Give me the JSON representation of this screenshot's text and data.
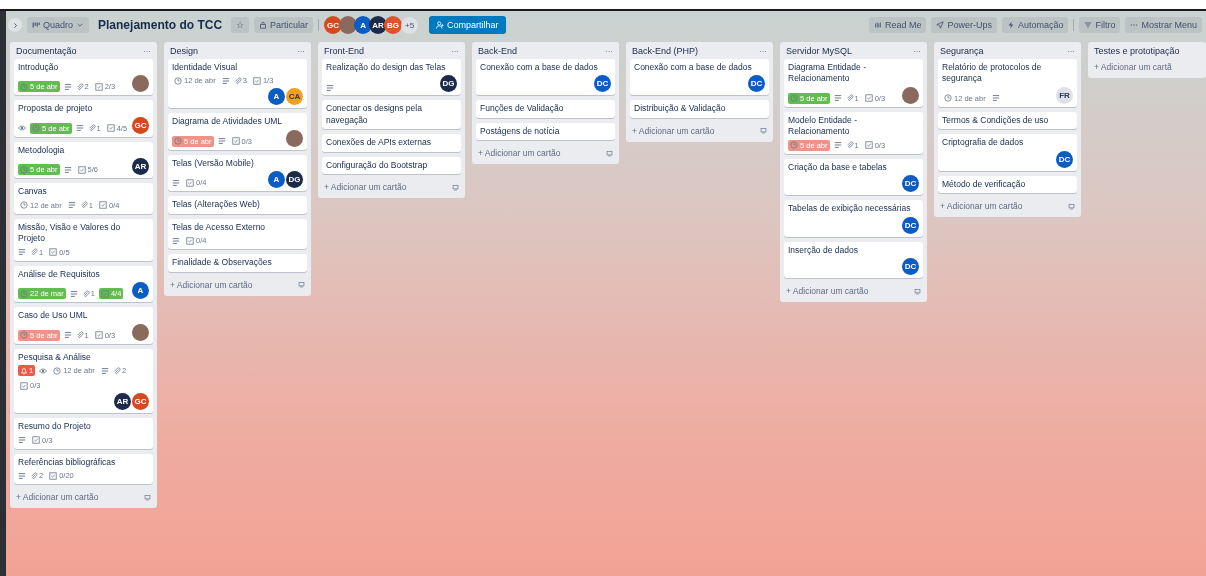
{
  "header": {
    "view_switcher": "Quadro",
    "board_title": "Planejamento do TCC",
    "star": "☆",
    "visibility": "Particular",
    "members": [
      {
        "kind": "initials",
        "text": "GC",
        "color": "#d24a1d"
      },
      {
        "kind": "photo"
      },
      {
        "kind": "initials",
        "text": "A",
        "color": "#0b5cc5"
      },
      {
        "kind": "initials",
        "text": "AR",
        "color": "#1d2b4a"
      },
      {
        "kind": "initials",
        "text": "BG",
        "color": "#e0522c"
      }
    ],
    "more_members": "+5",
    "share": "Compartilhar",
    "actions": [
      {
        "kind": "readme",
        "label": "Read Me"
      },
      {
        "kind": "powerups",
        "label": "Power-Ups"
      },
      {
        "kind": "automation",
        "label": "Automação"
      },
      {
        "kind": "filter",
        "label": "Filtro"
      },
      {
        "kind": "menu",
        "label": "Mostrar Menu"
      }
    ]
  },
  "lists": [
    {
      "title": "Documentação",
      "menu": "···",
      "cards": [
        {
          "title": "Introdução",
          "badges": [
            {
              "kind": "due",
              "text": "5 de abr",
              "complete": true,
              "overdue": false
            },
            {
              "kind": "description"
            },
            {
              "kind": "attachments",
              "text": "2"
            },
            {
              "kind": "checklist",
              "text": "2/3",
              "complete": false
            }
          ],
          "members": [
            {
              "kind": "photo"
            }
          ]
        },
        {
          "title": "Proposta de projeto",
          "badges": [
            {
              "kind": "watch"
            },
            {
              "kind": "due",
              "text": "5 de abr",
              "complete": true,
              "overdue": false
            },
            {
              "kind": "description"
            },
            {
              "kind": "attachments",
              "text": "1"
            },
            {
              "kind": "checklist",
              "text": "4/5",
              "complete": false
            }
          ],
          "members": [
            {
              "kind": "initials",
              "text": "GC",
              "color": "#d24a1d"
            }
          ]
        },
        {
          "title": "Metodologia",
          "badges": [
            {
              "kind": "due",
              "text": "5 de abr",
              "complete": true,
              "overdue": false
            },
            {
              "kind": "description"
            },
            {
              "kind": "checklist",
              "text": "5/6",
              "complete": false
            }
          ],
          "members": [
            {
              "kind": "initials",
              "text": "AR",
              "color": "#1d2b4a"
            }
          ]
        },
        {
          "title": "Canvas",
          "badges": [
            {
              "kind": "due",
              "text": "12 de abr",
              "complete": false,
              "overdue": false
            },
            {
              "kind": "description"
            },
            {
              "kind": "attachments",
              "text": "1"
            },
            {
              "kind": "checklist",
              "text": "0/4",
              "complete": false
            }
          ]
        },
        {
          "title": "Missão, Visão e Valores do Projeto",
          "badges": [
            {
              "kind": "description"
            },
            {
              "kind": "attachments",
              "text": "1"
            },
            {
              "kind": "checklist",
              "text": "0/5",
              "complete": false
            }
          ]
        },
        {
          "title": "Análise de Requisitos",
          "badges": [
            {
              "kind": "due",
              "text": "22 de mar",
              "complete": true,
              "overdue": false
            },
            {
              "kind": "description"
            },
            {
              "kind": "attachments",
              "text": "1"
            },
            {
              "kind": "checklist",
              "text": "4/4",
              "complete": true
            }
          ],
          "members": [
            {
              "kind": "initials",
              "text": "A",
              "color": "#0b5cc5"
            }
          ]
        },
        {
          "title": "Caso de Uso UML",
          "badges": [
            {
              "kind": "due",
              "text": "5 de abr",
              "complete": false,
              "overdue": true
            },
            {
              "kind": "description"
            },
            {
              "kind": "attachments",
              "text": "1"
            },
            {
              "kind": "checklist",
              "text": "0/3",
              "complete": false
            }
          ],
          "members": [
            {
              "kind": "photo"
            }
          ]
        },
        {
          "title": "Pesquisa & Análise",
          "badges": [
            {
              "kind": "notification",
              "text": "1"
            },
            {
              "kind": "watch"
            },
            {
              "kind": "due",
              "text": "12 de abr",
              "complete": false,
              "overdue": false
            },
            {
              "kind": "description"
            },
            {
              "kind": "attachments",
              "text": "2"
            },
            {
              "kind": "checklist",
              "text": "0/3",
              "complete": false
            }
          ],
          "members": [
            {
              "kind": "initials",
              "text": "AR",
              "color": "#1d2b4a"
            },
            {
              "kind": "initials",
              "text": "GC",
              "color": "#d24a1d"
            }
          ]
        },
        {
          "title": "Resumo do Projeto",
          "badges": [
            {
              "kind": "description"
            },
            {
              "kind": "checklist",
              "text": "0/3",
              "complete": false
            }
          ]
        },
        {
          "title": "Referências bibliográficas",
          "badges": [
            {
              "kind": "description"
            },
            {
              "kind": "attachments",
              "text": "2"
            },
            {
              "kind": "checklist",
              "text": "0/20",
              "complete": false
            }
          ]
        }
      ],
      "add_card": "+ Adicionar um cartão",
      "template": true
    },
    {
      "title": "Design",
      "menu": "···",
      "cards": [
        {
          "title": "Identidade Visual",
          "badges": [
            {
              "kind": "due",
              "text": "12 de abr",
              "complete": false,
              "overdue": false
            },
            {
              "kind": "description"
            },
            {
              "kind": "attachments",
              "text": "3"
            },
            {
              "kind": "checklist",
              "text": "1/3",
              "complete": false
            }
          ],
          "members": [
            {
              "kind": "initials",
              "text": "A",
              "color": "#0b5cc5"
            },
            {
              "kind": "initials",
              "text": "CA",
              "color": "#f0a020"
            }
          ]
        },
        {
          "title": "Diagrama de Atividades UML",
          "badges": [
            {
              "kind": "due",
              "text": "5 de abr",
              "complete": false,
              "overdue": true
            },
            {
              "kind": "description"
            },
            {
              "kind": "checklist",
              "text": "0/3",
              "complete": false
            }
          ],
          "members": [
            {
              "kind": "photo"
            }
          ]
        },
        {
          "title": "Telas (Versão Mobile)",
          "badges": [
            {
              "kind": "description"
            },
            {
              "kind": "checklist",
              "text": "0/4",
              "complete": false
            }
          ],
          "members": [
            {
              "kind": "initials",
              "text": "A",
              "color": "#0b5cc5"
            },
            {
              "kind": "initials",
              "text": "DG",
              "color": "#1d2b4a"
            }
          ]
        },
        {
          "title": "Telas (Alterações Web)"
        },
        {
          "title": "Telas de Acesso Externo",
          "badges": [
            {
              "kind": "description"
            },
            {
              "kind": "checklist",
              "text": "0/4",
              "complete": false
            }
          ]
        },
        {
          "title": "Finalidade & Observações"
        }
      ],
      "add_card": "+ Adicionar um cartão",
      "template": true
    },
    {
      "title": "Front-End",
      "menu": "···",
      "cards": [
        {
          "title": "Realização do design das Telas",
          "badges": [
            {
              "kind": "description"
            }
          ],
          "members": [
            {
              "kind": "initials",
              "text": "DG",
              "color": "#1d2b4a"
            }
          ]
        },
        {
          "title": "Conectar os designs pela navegação"
        },
        {
          "title": "Conexões de APIs externas"
        },
        {
          "title": "Configuração do Bootstrap"
        }
      ],
      "add_card": "+ Adicionar um cartão",
      "template": true
    },
    {
      "title": "Back-End",
      "menu": "···",
      "cards": [
        {
          "title": "Conexão com a base de dados",
          "members": [
            {
              "kind": "initials",
              "text": "DC",
              "color": "#0b5cc5"
            }
          ]
        },
        {
          "title": "Funções de Validação"
        },
        {
          "title": "Postágens de notícia"
        }
      ],
      "add_card": "+ Adicionar um cartão",
      "template": true
    },
    {
      "title": "Back-End (PHP)",
      "menu": "···",
      "cards": [
        {
          "title": "Conexão com a base de dados",
          "members": [
            {
              "kind": "initials",
              "text": "DC",
              "color": "#0b5cc5"
            }
          ]
        },
        {
          "title": "Distribuição & Validação"
        }
      ],
      "add_card": "+ Adicionar um cartão",
      "template": true
    },
    {
      "title": "Servidor MySQL",
      "menu": "···",
      "cards": [
        {
          "title": "Diagrama Entidade - Relacionamento",
          "badges": [
            {
              "kind": "due",
              "text": "5 de abr",
              "complete": true,
              "overdue": false
            },
            {
              "kind": "description"
            },
            {
              "kind": "attachments",
              "text": "1"
            },
            {
              "kind": "checklist",
              "text": "0/3",
              "complete": false
            }
          ],
          "members": [
            {
              "kind": "photo"
            }
          ]
        },
        {
          "title": "Modelo Entidade - Relacionamento",
          "badges": [
            {
              "kind": "due",
              "text": "5 de abr",
              "complete": false,
              "overdue": true
            },
            {
              "kind": "description"
            },
            {
              "kind": "attachments",
              "text": "1"
            },
            {
              "kind": "checklist",
              "text": "0/3",
              "complete": false
            }
          ]
        },
        {
          "title": "Criação da base e tabelas",
          "members": [
            {
              "kind": "initials",
              "text": "DC",
              "color": "#0b5cc5"
            }
          ]
        },
        {
          "title": "Tabelas de exibição necessárias",
          "members": [
            {
              "kind": "initials",
              "text": "DC",
              "color": "#0b5cc5"
            }
          ]
        },
        {
          "title": "Inserção de dados",
          "members": [
            {
              "kind": "initials",
              "text": "DC",
              "color": "#0b5cc5"
            }
          ]
        }
      ],
      "add_card": "+ Adicionar um cartão",
      "template": true
    },
    {
      "title": "Segurança",
      "menu": "···",
      "cards": [
        {
          "title": "Relatório de protocolos de segurança",
          "badges": [
            {
              "kind": "due",
              "text": "12 de abr",
              "complete": false,
              "overdue": false
            },
            {
              "kind": "description"
            }
          ],
          "members": [
            {
              "kind": "initials",
              "text": "FR",
              "color": "#dfe1e6"
            }
          ]
        },
        {
          "title": "Termos & Condições de uso"
        },
        {
          "title": "Criptografia de dados",
          "members": [
            {
              "kind": "initials",
              "text": "DC",
              "color": "#0b5cc5"
            }
          ]
        },
        {
          "title": "Método de verificação"
        }
      ],
      "add_card": "+ Adicionar um cartão",
      "template": true
    },
    {
      "title": "Testes e prototipação",
      "add_card": "+ Adicionar um cartã",
      "template": false
    }
  ]
}
